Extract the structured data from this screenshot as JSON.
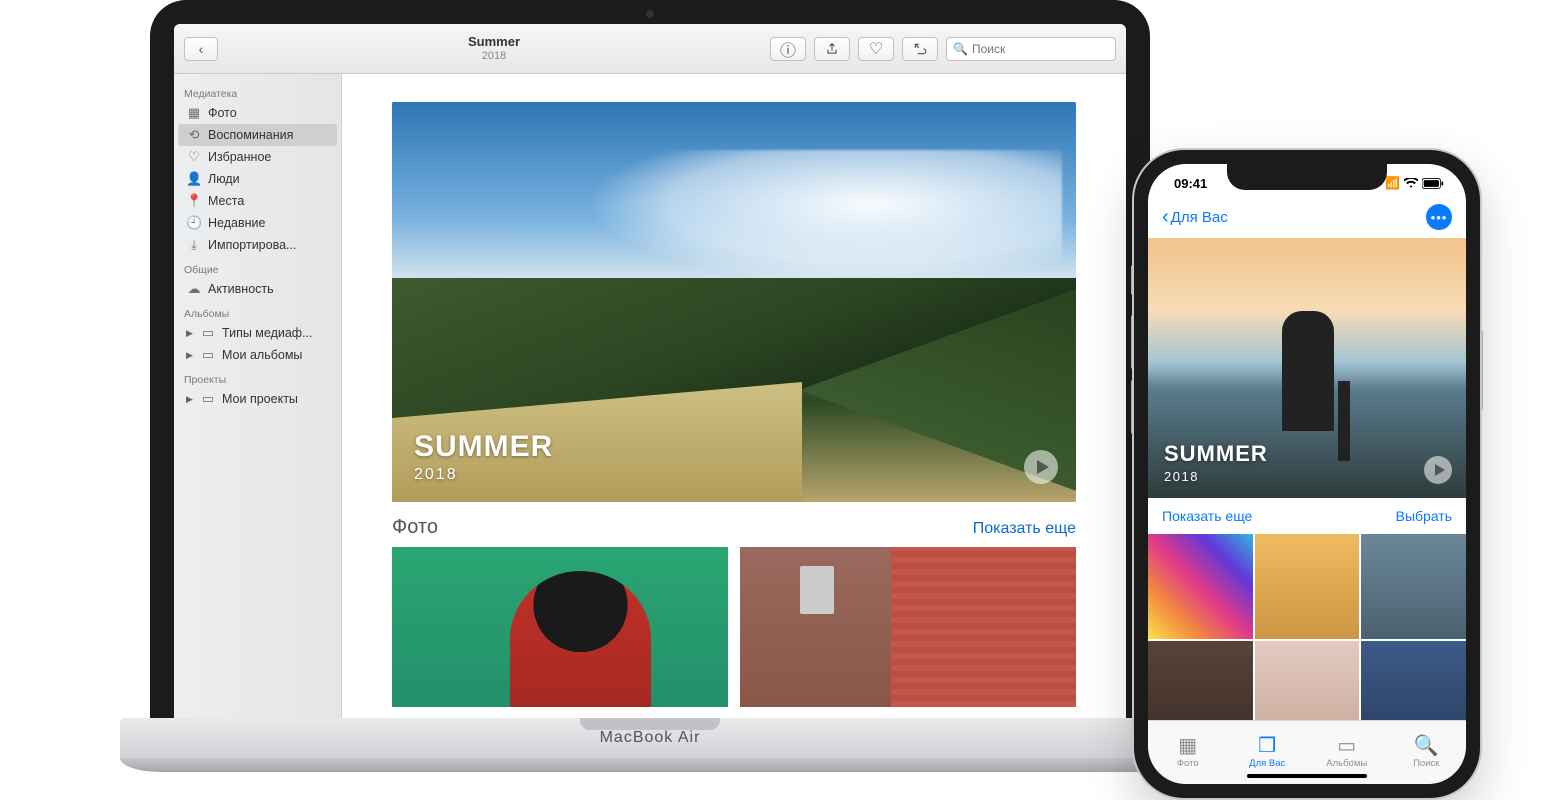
{
  "mac": {
    "device_label": "MacBook Air",
    "toolbar": {
      "title": "Summer",
      "subtitle": "2018",
      "search_placeholder": "Поиск"
    },
    "sidebar": {
      "section_library": "Медиатека",
      "items_library": [
        {
          "icon": "photos",
          "label": "Фото"
        },
        {
          "icon": "memories",
          "label": "Воспоминания",
          "selected": true
        },
        {
          "icon": "heart",
          "label": "Избранное"
        },
        {
          "icon": "people",
          "label": "Люди"
        },
        {
          "icon": "places",
          "label": "Места"
        },
        {
          "icon": "clock",
          "label": "Недавние"
        },
        {
          "icon": "import",
          "label": "Импортирова..."
        }
      ],
      "section_shared": "Общие",
      "items_shared": [
        {
          "icon": "cloud",
          "label": "Активность"
        }
      ],
      "section_albums": "Альбомы",
      "items_albums": [
        {
          "icon": "folder",
          "label": "Типы медиаф...",
          "disclose": true
        },
        {
          "icon": "folder",
          "label": "Мои альбомы",
          "disclose": true
        }
      ],
      "section_projects": "Проекты",
      "items_projects": [
        {
          "icon": "folder",
          "label": "Мои проекты",
          "disclose": true
        }
      ]
    },
    "hero": {
      "title": "SUMMER",
      "subtitle": "2018"
    },
    "section_photos_title": "Фото",
    "show_more": "Показать еще"
  },
  "iphone": {
    "status_time": "09:41",
    "nav_back": "Для Вас",
    "hero": {
      "title": "SUMMER",
      "subtitle": "2018"
    },
    "show_more": "Показать еще",
    "select": "Выбрать",
    "tabs": [
      {
        "icon": "photo",
        "label": "Фото"
      },
      {
        "icon": "foryou",
        "label": "Для Вас",
        "active": true
      },
      {
        "icon": "albums",
        "label": "Альбомы"
      },
      {
        "icon": "search",
        "label": "Поиск"
      }
    ]
  }
}
